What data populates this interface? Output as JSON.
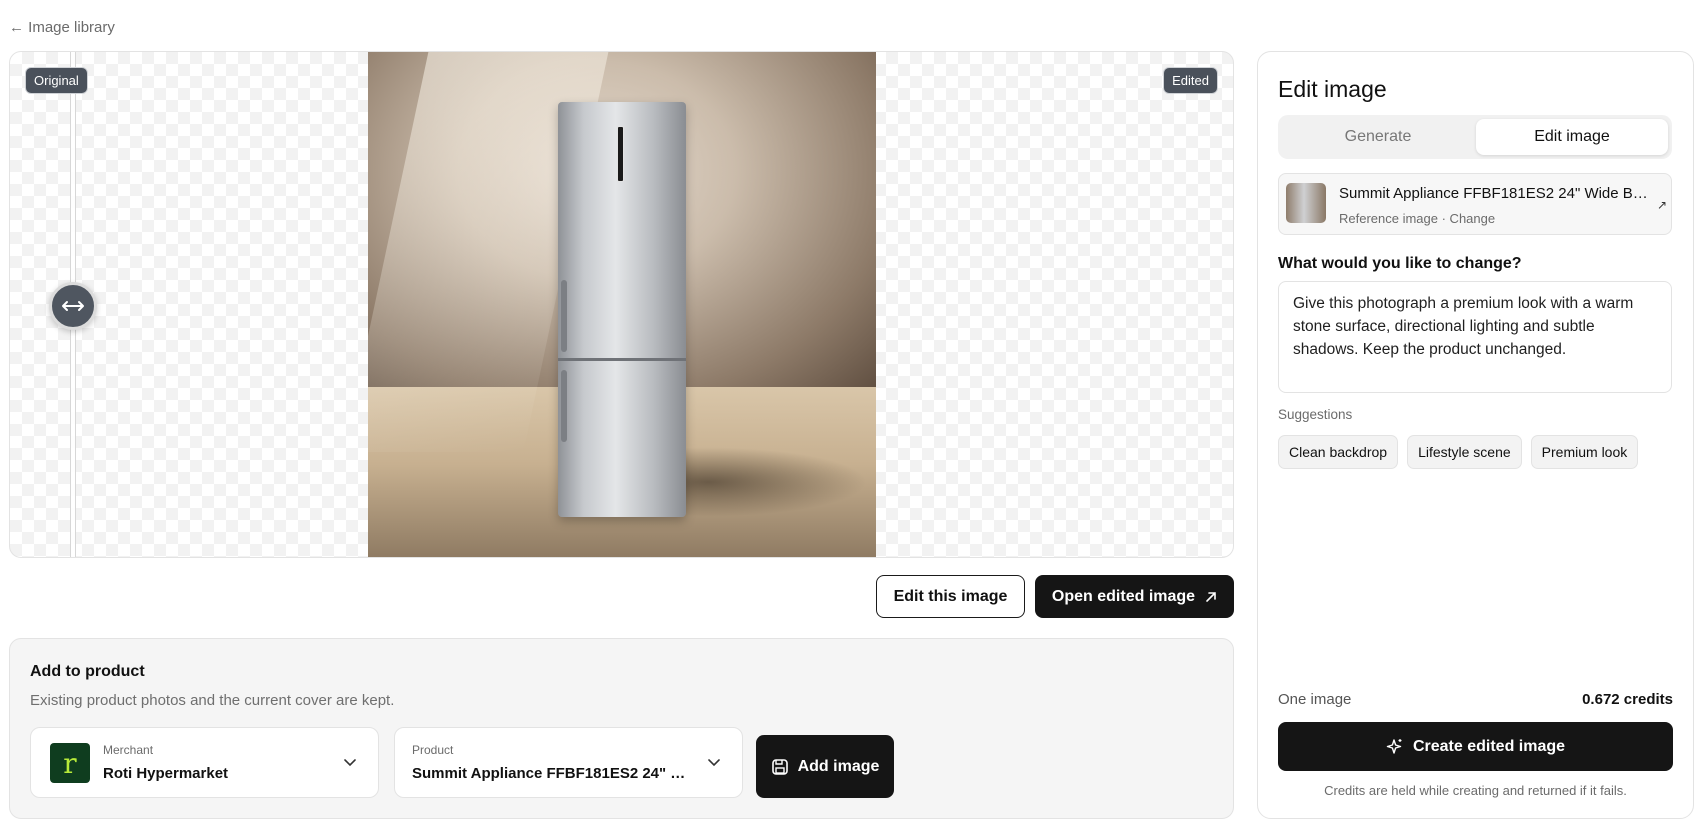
{
  "nav": {
    "back_label": "← Image library"
  },
  "viewer": {
    "original_tag": "Original",
    "edited_tag": "Edited",
    "slider_position_percent": 5
  },
  "actions": {
    "edit_this_image": "Edit this image",
    "open_edited_image": "Open edited image"
  },
  "add_to_product": {
    "heading": "Add to product",
    "subtitle": "Existing product photos and the current cover are kept.",
    "merchant": {
      "label": "Merchant",
      "value": "Roti Hypermarket",
      "logo_letter": "r"
    },
    "product": {
      "label": "Product",
      "value": "Summit Appliance FFBF181ES2 24\" Wi..."
    },
    "add_button": "Add image"
  },
  "panel": {
    "title": "Edit image",
    "tabs": [
      {
        "label": "Generate",
        "active": false
      },
      {
        "label": "Edit image",
        "active": true
      }
    ],
    "reference": {
      "name": "Summit Appliance FFBF181ES2 24\" Wide Bot...",
      "meta": "Reference image · Change"
    },
    "question": "What would you like to change?",
    "prompt_value": "Give this photograph a premium look with a warm stone surface, directional lighting and subtle shadows. Keep the product unchanged.",
    "suggestions_label": "Suggestions",
    "suggestions": [
      "Clean backdrop",
      "Lifestyle scene",
      "Premium look"
    ],
    "cost_label": "One image",
    "cost_value": "0.672 credits",
    "create_button": "Create edited image",
    "note": "Credits are held while creating and returned if it fails."
  },
  "icons": {
    "handle": "arrows-horizontal-icon",
    "open_external": "arrow-up-right-icon",
    "save": "save-icon",
    "sparkle": "sparkle-icon",
    "chevron": "chevron-down-icon"
  }
}
